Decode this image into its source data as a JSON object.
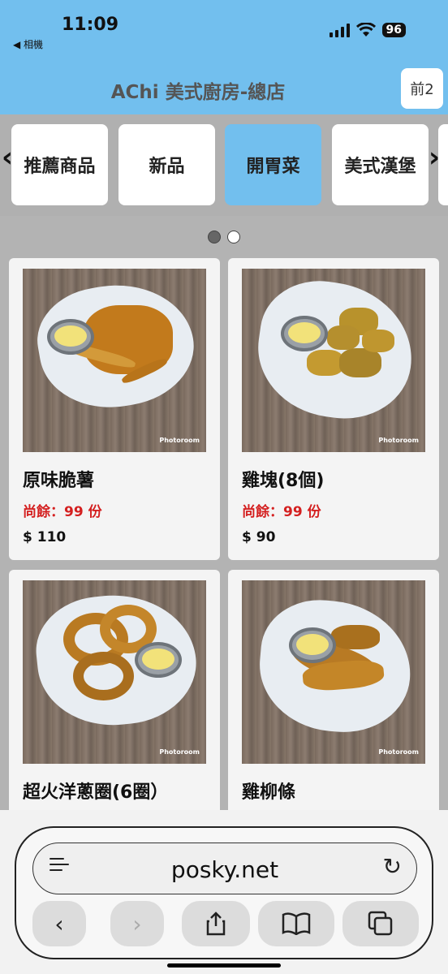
{
  "status_bar": {
    "time": "11:09",
    "back_app": "◀ 相機",
    "battery": "96"
  },
  "header": {
    "title": "AChi 美式廚房-總店",
    "lang_button": "前2"
  },
  "categories": [
    {
      "label": "推薦商品",
      "active": false
    },
    {
      "label": "新品",
      "active": false
    },
    {
      "label": "開胃菜",
      "active": true
    },
    {
      "label": "美式漢堡",
      "active": false
    }
  ],
  "arrows": {
    "left": "‹",
    "right": "›"
  },
  "products": [
    {
      "name": "原味脆薯",
      "stock": "尚餘：99 份",
      "price": "$ 110",
      "watermark": "Photoroom"
    },
    {
      "name": "雞塊(8個)",
      "stock": "尚餘：99 份",
      "price": "$ 90",
      "watermark": "Photoroom"
    },
    {
      "name": "超火洋蔥圈(6圈）",
      "watermark": "Photoroom"
    },
    {
      "name": "雞柳條",
      "watermark": "Photoroom"
    }
  ],
  "browser": {
    "url": "posky.net",
    "icons": [
      "page-menu-icon",
      "reload-icon",
      "back-icon",
      "forward-icon",
      "share-icon",
      "bookmarks-icon",
      "tabs-icon"
    ],
    "back": "‹",
    "forward": "›",
    "share": "⇪",
    "bookmarks": "📖",
    "tabs": "⧉",
    "reload": "↻"
  },
  "colors": {
    "accent": "#72bfee",
    "stock_red": "#d42020",
    "background": "#b3b3b3"
  }
}
